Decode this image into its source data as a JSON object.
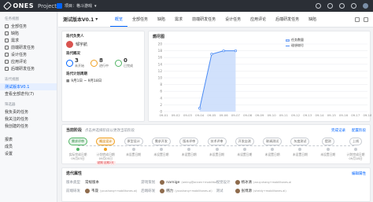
{
  "topbar": {
    "logo": "ONES",
    "product": "Project",
    "project_label": "项目：格斗游戏",
    "chevron": "chevron-down-icon"
  },
  "sidebar": {
    "section1": "任务视图",
    "items": [
      {
        "label": "全部任务"
      },
      {
        "label": "缺陷"
      },
      {
        "label": "需求"
      },
      {
        "label": "前端研发任务"
      },
      {
        "label": "设计任务"
      },
      {
        "label": "应用评论"
      },
      {
        "label": "后端研发任务"
      }
    ],
    "section2": "迭代视图",
    "iter_items": [
      {
        "label": "测试版本V0.1"
      },
      {
        "label": "查看全部迭代(7)"
      }
    ],
    "section3": "筛选器",
    "filter_items": [
      {
        "label": "我负责的任务"
      },
      {
        "label": "我关注的任务"
      },
      {
        "label": "我创建的任务"
      }
    ],
    "bottom_items": [
      {
        "label": "报表"
      },
      {
        "label": "成员"
      },
      {
        "label": "设置"
      }
    ]
  },
  "header": {
    "version": "测试版本V0.1",
    "tabs": [
      "概览",
      "全部任务",
      "缺陷",
      "需求",
      "前端研发任务",
      "设计任务",
      "应用评论",
      "后端研发任务",
      "缺陷"
    ]
  },
  "info": {
    "owner_label": "迭代负责人",
    "owner": "邹宇航",
    "status_label": "迭代概况",
    "stats": [
      {
        "num": "3",
        "label": "未开始",
        "color": "#0064ff"
      },
      {
        "num": "8",
        "label": "进行中",
        "color": "#f0a020"
      },
      {
        "num": "0",
        "label": "已完成",
        "color": "#52b566"
      }
    ],
    "cycle_label": "迭代计划周期",
    "cycle": "9月1日 ~ 9月18日"
  },
  "burndown": {
    "title": "燃尽图",
    "legend_bar": "任务数量",
    "legend_line": "理想燃尽"
  },
  "chart_data": {
    "type": "area",
    "title": "燃尽图",
    "x": [
      "09-01",
      "09-02",
      "09-03",
      "09-04",
      "09-05",
      "09-06",
      "09-07",
      "09-08",
      "09-09",
      "09-10",
      "09-11",
      "09-12",
      "09-13",
      "09-14",
      "09-15",
      "09-16",
      "09-17",
      "09-18"
    ],
    "series": [
      {
        "name": "任务数量",
        "values": [
          null,
          null,
          null,
          1,
          17,
          18,
          18,
          null,
          null,
          null,
          null,
          null,
          null,
          null,
          null,
          null,
          null,
          null
        ]
      }
    ],
    "yticks": [
      0,
      2,
      4,
      6,
      8,
      10,
      12,
      14,
      16,
      18,
      20
    ],
    "ylim": [
      0,
      20
    ],
    "grid": true,
    "legend": "top-right"
  },
  "stages_panel": {
    "title": "当前阶段",
    "hint": "点击并选择阶段以更改当前阶段",
    "link1": "完成记录",
    "link2": "配置阶段",
    "stages": [
      {
        "name": "需求评审",
        "state": "done",
        "sub1": "实际完成日期",
        "sub2": "09月03日"
      },
      {
        "name": "概念设计",
        "state": "cur",
        "sub1": "计划完成日期",
        "sub2": "09月05日",
        "warn": "超期",
        "warn_text": "延期2天"
      },
      {
        "name": "原型设计",
        "state": "todo",
        "sub1": "未设置日期"
      },
      {
        "name": "需求开发",
        "state": "todo",
        "sub1": "未设置日期"
      },
      {
        "name": "版本评审",
        "state": "todo",
        "sub1": "未设置日期"
      },
      {
        "name": "技术评审",
        "state": "todo",
        "sub1": "未设置日期"
      },
      {
        "name": "开发自测",
        "state": "todo",
        "sub1": "未设置日期"
      },
      {
        "name": "联调测试",
        "state": "todo",
        "sub1": "未设置日期"
      },
      {
        "name": "灰度测试",
        "state": "todo",
        "sub1": "未设置日期"
      },
      {
        "name": "提测",
        "state": "todo",
        "sub1": "未设置日期"
      },
      {
        "name": "上线",
        "state": "todo",
        "sub1": "计划完成日期",
        "sub2": "09月18日"
      }
    ]
  },
  "props": {
    "title": "迭代属性",
    "edit": "编辑属性",
    "rows": [
      [
        {
          "k": "版本类型",
          "v": "常规版本"
        },
        {
          "k": "游戏策划",
          "v": "narnige",
          "em": "(aming@annen+mobilitones.ai)"
        },
        {
          "k": "视觉设计",
          "v": "杨冰清",
          "em": "(zouyuhang+mobilitones.ai)"
        },
        {
          "k": "",
          "v": ""
        }
      ],
      [
        {
          "k": "前端研发",
          "v": "韦晟",
          "em": "(youshang+mobilitones.ai)"
        },
        {
          "k": "后端研发",
          "v": "韩力",
          "em": "(youshang+mobilitones.ai)"
        },
        {
          "k": "测试",
          "v": "张博源",
          "em": "(sheldy+mobilitones.ai)"
        },
        {
          "k": "",
          "v": ""
        }
      ]
    ]
  }
}
